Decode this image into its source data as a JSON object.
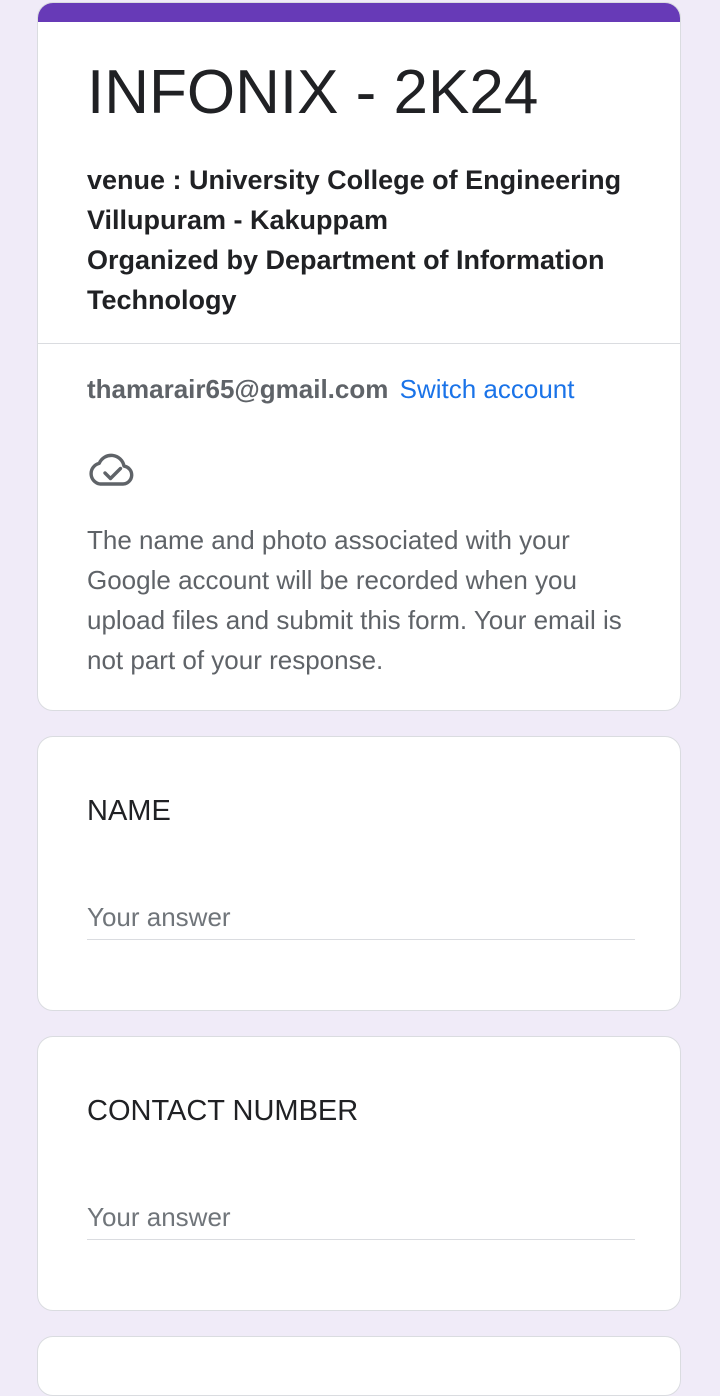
{
  "form": {
    "accent_color": "#673ab7",
    "title": "INFONIX - 2K24",
    "description_lines": [
      "venue : University College of Engineering",
      "Villupuram - Kakuppam",
      "Organized by Department of Information",
      "Technology"
    ]
  },
  "account": {
    "email": "thamarair65@gmail.com",
    "switch_label": "Switch account",
    "icon": "cloud-done-icon",
    "notice": "The name and photo associated with your Google account will be recorded when you upload files and submit this form. Your email is not part of your response."
  },
  "questions": [
    {
      "title": "NAME",
      "placeholder": "Your answer"
    },
    {
      "title": "CONTACT NUMBER",
      "placeholder": "Your answer"
    }
  ]
}
